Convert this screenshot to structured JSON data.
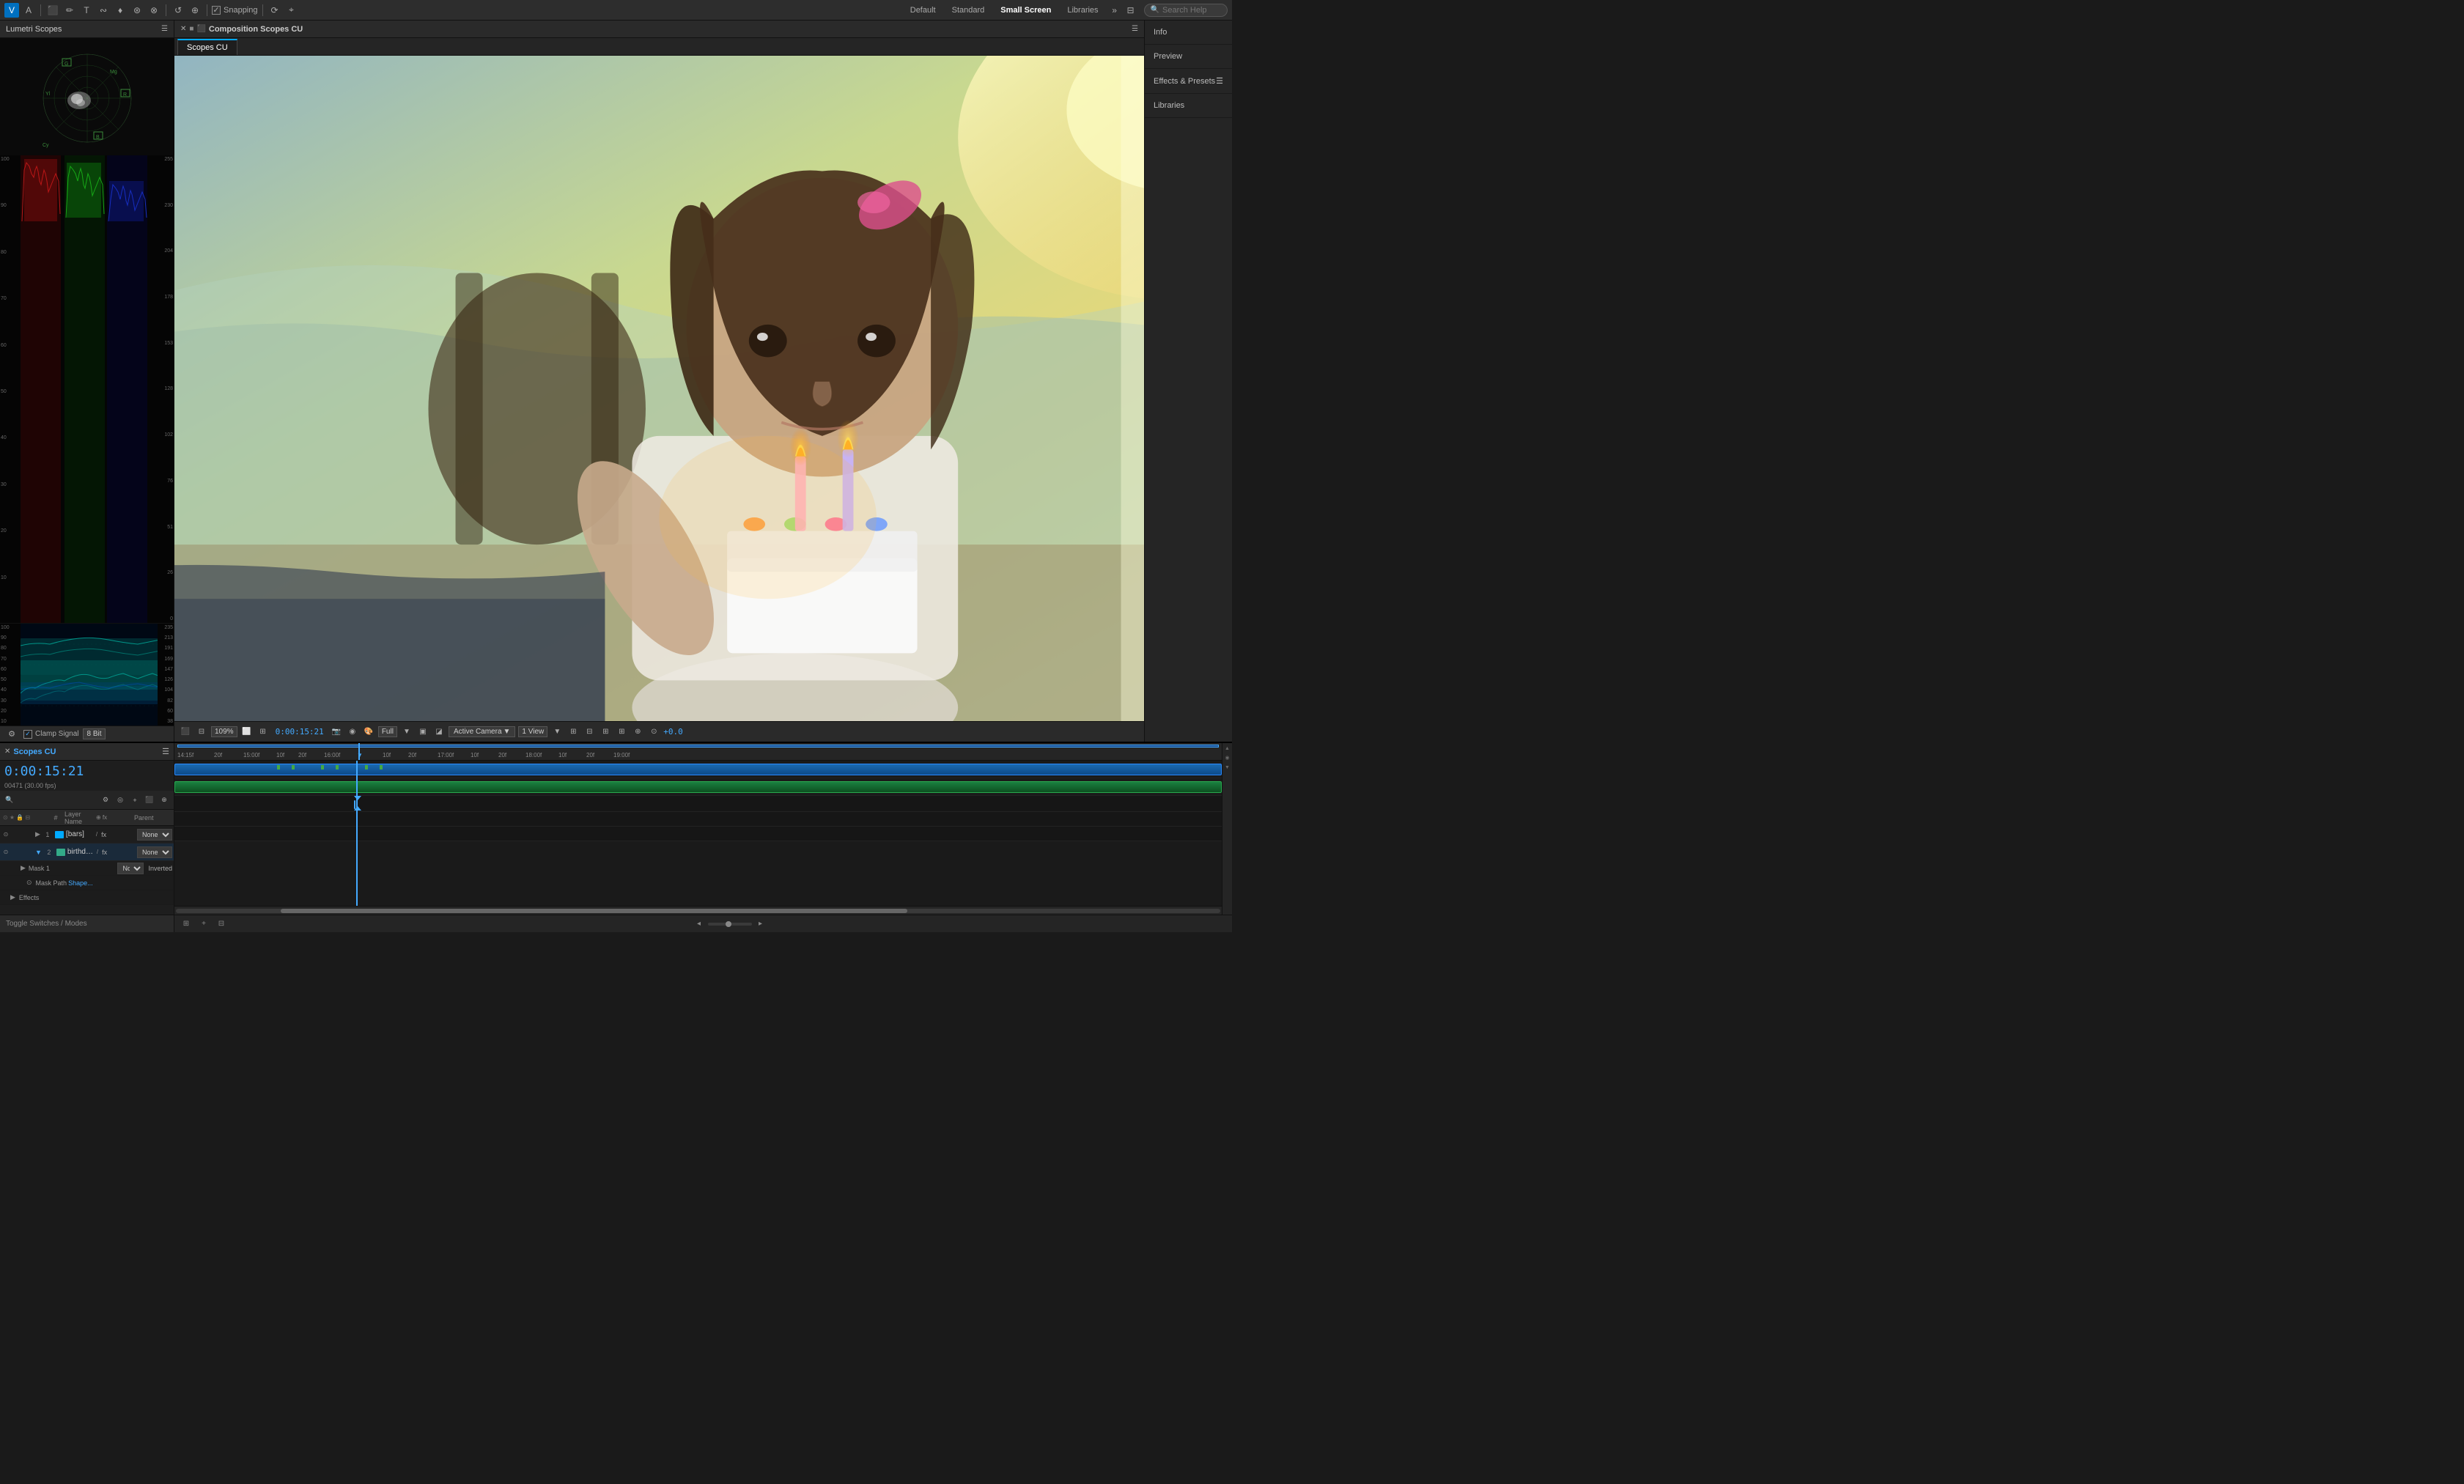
{
  "toolbar": {
    "snapping_label": "Snapping",
    "workspace_tabs": [
      "Default",
      "Standard",
      "Small Screen",
      "Libraries"
    ],
    "search_placeholder": "Search Help",
    "tools": [
      "V",
      "A",
      "⬛",
      "✏",
      "T",
      "I",
      "✒",
      "🖊",
      "🔍",
      "⊕",
      "⊙",
      "⊗",
      "◯",
      "⬡",
      "✂",
      "☰",
      "📌"
    ]
  },
  "lumetri": {
    "title": "Lumetri Scopes",
    "clamp_label": "Clamp Signal",
    "bit_label": "8 Bit",
    "left_labels_top": [
      "100",
      "90",
      "80",
      "70",
      "60",
      "50",
      "40",
      "30",
      "20",
      "10",
      ""
    ],
    "left_labels_bottom": [
      "235",
      "213",
      "191",
      "169",
      "147",
      "126",
      "104",
      "82",
      "60",
      "38"
    ],
    "right_labels_top": [
      "255",
      "230",
      "204",
      "178",
      "153",
      "128",
      "102",
      "76",
      "51",
      "26",
      "0"
    ],
    "right_labels_bottom": [
      "235",
      "213",
      "191",
      "169",
      "147",
      "126",
      "104",
      "82",
      "60",
      "38"
    ]
  },
  "composition": {
    "title": "Composition Scopes CU",
    "tab_name": "Scopes CU",
    "timecode": "0:00:15:21",
    "zoom": "109%",
    "quality": "Full",
    "camera": "Active Camera",
    "view": "1 View",
    "exposure": "+0.0"
  },
  "right_panel": {
    "items": [
      "Info",
      "Preview",
      "Effects & Presets",
      "Libraries"
    ]
  },
  "timeline": {
    "title": "Scopes CU",
    "timecode": "0:00:15:21",
    "fps": "00471 (30.00 fps)",
    "layers": [
      {
        "num": "1",
        "type": "comp",
        "name": "[bars]",
        "fx": "fx",
        "parent": "None"
      },
      {
        "num": "2",
        "type": "video",
        "name": "birthdaygirl",
        "fx": "fx",
        "parent": "None",
        "expanded": true,
        "mask": {
          "name": "Mask 1",
          "mode": "None",
          "inverted": "Inverted",
          "path": "Shape..."
        }
      }
    ],
    "layer_header": {
      "num": "#",
      "name": "Layer Name",
      "parent": "Parent"
    },
    "ruler_marks": [
      "14:15f",
      "20f",
      "15:00f",
      "10f",
      "20f",
      "16:00f",
      "10f",
      "20f",
      "17:00f",
      "10f",
      "20f",
      "18:00f",
      "10f",
      "20f",
      "19:00f"
    ],
    "toggle_bar": "Toggle Switches / Modes"
  }
}
